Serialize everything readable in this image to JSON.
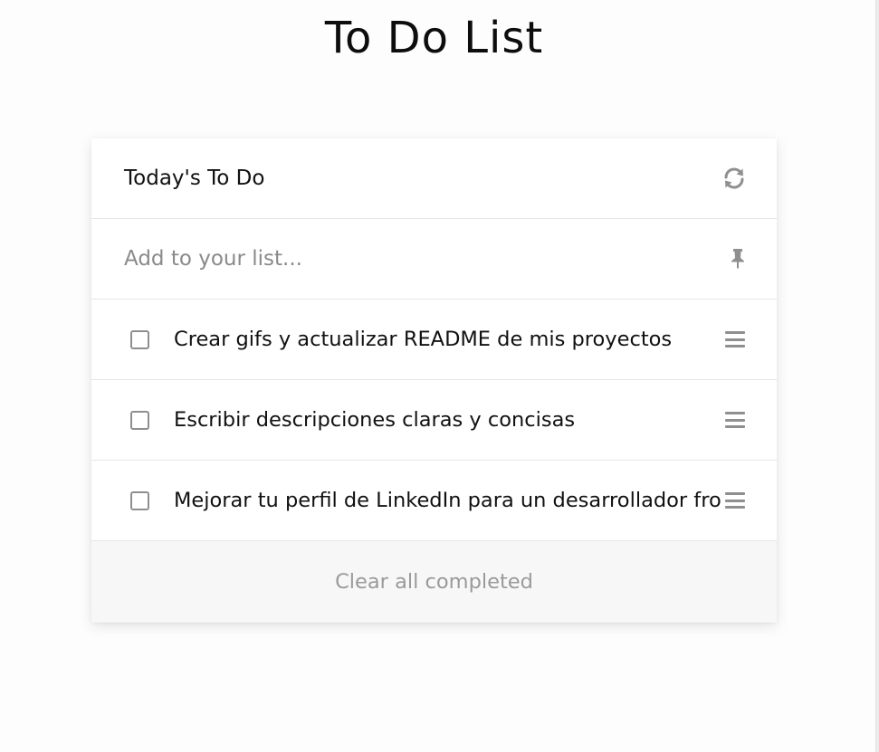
{
  "page": {
    "title": "To Do List"
  },
  "card": {
    "header_title": "Today's To Do",
    "refresh_icon": "refresh-icon",
    "add_placeholder": "Add to your list...",
    "add_value": "",
    "pin_icon": "pin-icon",
    "footer_label": "Clear all completed"
  },
  "todos": [
    {
      "text": "Crear gifs y actualizar README de mis proyectos",
      "checked": false
    },
    {
      "text": "Escribir descripciones claras y concisas",
      "checked": false
    },
    {
      "text": "Mejorar tu perfil de LinkedIn para un desarrollador front-end",
      "checked": false
    }
  ],
  "colors": {
    "icon_gray": "#8f8f8f",
    "footer_bg": "#f7f7f7",
    "footer_text": "#9a9a9a"
  }
}
